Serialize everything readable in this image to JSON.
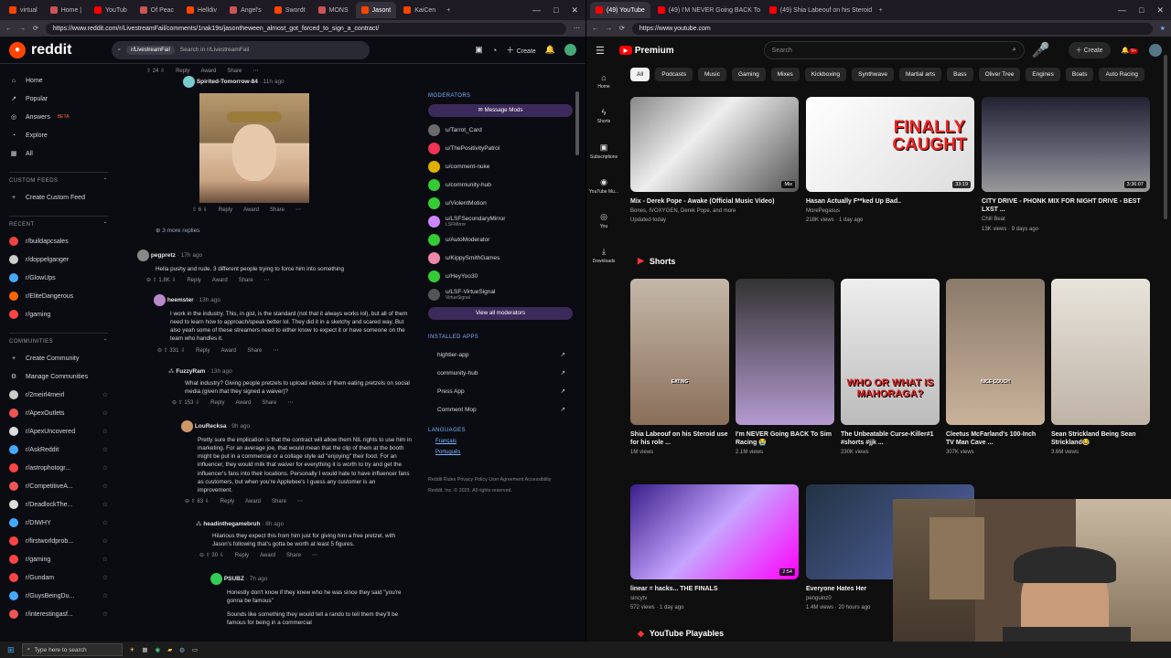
{
  "left_browser": {
    "tabs": [
      {
        "label": "virtual",
        "color": "#ff4500"
      },
      {
        "label": "Home |",
        "color": "#c55"
      },
      {
        "label": "YouTub",
        "color": "#f00"
      },
      {
        "label": "Of Peac",
        "color": "#c55"
      },
      {
        "label": "Helldiv",
        "color": "#ff4500"
      },
      {
        "label": "Angel's",
        "color": "#c55"
      },
      {
        "label": "Swordt",
        "color": "#ff4500"
      },
      {
        "label": "MONS",
        "color": "#c55"
      },
      {
        "label": "Jasont",
        "color": "#ff4500"
      },
      {
        "label": "KaiCen",
        "color": "#ff4500"
      }
    ],
    "url": "https://www.reddit.com/r/LivestreamFail/comments/1nak19s/jasontheween_almost_got_forced_to_sign_a_contract/"
  },
  "reddit": {
    "brand": "reddit",
    "search_chip": "r/LivestreamFail",
    "search_placeholder": "Search in r/LivestreamFail",
    "create": "Create",
    "nav": [
      "Home",
      "Popular",
      "Answers",
      "Explore",
      "All"
    ],
    "beta": "BETA",
    "custom_feeds_hdr": "CUSTOM FEEDS",
    "create_feed": "Create Custom Feed",
    "recent_hdr": "RECENT",
    "recent": [
      "r/buildapcsales",
      "r/doppelganger",
      "r/GlowUps",
      "r/EliteDangerous",
      "r/gaming"
    ],
    "communities_hdr": "COMMUNITIES",
    "create_community": "Create Community",
    "manage_communities": "Manage Communities",
    "communities": [
      "r/2meirl4meirl",
      "r/ApexOutlets",
      "r/ApexUncovered",
      "r/AskReddit",
      "r/astrophotogr...",
      "r/CompetitiveA...",
      "r/DeadlockThe...",
      "r/DIWHY",
      "r/firstworldprob...",
      "r/gaming",
      "r/Gundam",
      "r/GuysBeingDu...",
      "r/interestingasf..."
    ],
    "comments": [
      {
        "author": "Spirited-Tomorrow-84",
        "time": "· 11h ago",
        "votes": "6",
        "more": "3 more replies"
      },
      {
        "author": "pegpretz",
        "time": "· 17h ago",
        "body": "Hella pushy and rude. 3 different people trying to force him into something",
        "votes": "1.8K"
      },
      {
        "author": "heemster",
        "time": "· 13h ago",
        "body": "I work in the industry. This, in gist, is the standard (not that it always works lol), but all of them need to learn how to approach/speak better lol. They did it in a sketchy and scared way. But also yeah some of these streamers need to either know to expect it or have someone on the team who handles it.",
        "votes": "331"
      },
      {
        "author": "FuzzyRam",
        "time": "· 13h ago",
        "body": "What industry? Giving people pretzels to upload videos of them eating pretzels on social media (given that they signed a waiver)?",
        "votes": "153"
      },
      {
        "author": "LouRecksa",
        "time": "· 9h ago",
        "body": "Pretty sure the implication is that the contract will allow them NIL rights to use him in marketing. For an average joe, that would mean that the clip of them at the booth might be put in a commercial or a collage style ad \"enjoying\" their food. For an influencer, they would milk that waiver for everything it is worth to try and get the influencer's fans into their locations. Personally I would hate to have influencer fans as customers, but when you're Applebee's I guess any customer is an improvement.",
        "votes": "83"
      },
      {
        "author": "headinthegamebruh",
        "time": "· 8h ago",
        "body": "Hilarious they expect this from him just for giving him a free pretzel. with Jason's following that's gotta be worth at least 5 figures.",
        "votes": "30"
      },
      {
        "author": "PSUBZ",
        "time": "· 7h ago",
        "body": "Honestly don't know if they knew who he was since they said \"you're gonna be famous\"",
        "body2": "Sounds like something they would tell a rando to tell them they'll be famous for being in a commercial"
      }
    ],
    "top_votes": "24",
    "actions": {
      "reply": "Reply",
      "award": "Award",
      "share": "Share"
    },
    "moderators_hdr": "MODERATORS",
    "message_mods": "Message Mods",
    "moderators": [
      {
        "name": "u/Tarrot_Card",
        "sub": "",
        "color": "#6a6a6a"
      },
      {
        "name": "u/ThePositivityPatrol",
        "sub": "",
        "color": "#e35"
      },
      {
        "name": "u/comment-nuke",
        "sub": "",
        "color": "#e0b000"
      },
      {
        "name": "u/community-hub",
        "sub": "",
        "color": "#3c3"
      },
      {
        "name": "u/ViolentMotion",
        "sub": "",
        "color": "#3c3"
      },
      {
        "name": "u/LSFSecondaryMirror",
        "sub": "LSFMirror",
        "color": "#c8f"
      },
      {
        "name": "u/AutoModerator",
        "sub": "",
        "color": "#3c3"
      },
      {
        "name": "u/KippySmithGames",
        "sub": "",
        "color": "#e8a"
      },
      {
        "name": "u/HeyYoo30",
        "sub": "",
        "color": "#3c3"
      },
      {
        "name": "u/LSF-VirtueSignal",
        "sub": "VirtueSignal",
        "color": "#555"
      }
    ],
    "view_all_mods": "View all moderators",
    "installed_apps_hdr": "INSTALLED APPS",
    "apps": [
      "hightier-app",
      "community-hub",
      "Press App",
      "Comment Mop"
    ],
    "languages_hdr": "LANGUAGES",
    "languages": [
      "Français",
      "Português"
    ],
    "footer": "Reddit Rules   Privacy Policy   User Agreement   Accessibility",
    "copyright": "Reddit, Inc. © 2025. All rights reserved."
  },
  "right_browser": {
    "tabs": [
      {
        "label": "(49) YouTube",
        "color": "#f00"
      },
      {
        "label": "(49) I'M NEVER Going BACK To Si",
        "color": "#f00"
      },
      {
        "label": "(49) Shia Labeouf on his Steroid",
        "color": "#f00"
      }
    ],
    "url": "https://www.youtube.com"
  },
  "youtube": {
    "brand": "Premium",
    "search_placeholder": "Search",
    "create": "Create",
    "notif_count": "9+",
    "sidebar": [
      "Home",
      "Shorts",
      "Subscriptions",
      "YouTube Mu...",
      "You",
      "Downloads"
    ],
    "chips": [
      "All",
      "Podcasts",
      "Music",
      "Gaming",
      "Mixes",
      "Kickboxing",
      "Synthwave",
      "Martial arts",
      "Bass",
      "Oliver Tree",
      "Engines",
      "Boats",
      "Auto Racing"
    ],
    "videos": [
      {
        "title": "Mix - Derek Pope - Awake (Official Music Video)",
        "meta1": "Bones, IVOXYGEN, Derek Pope, and more",
        "meta2": "Updated today",
        "dur": "Mix"
      },
      {
        "title": "Hasan Actually F**ked Up Bad..",
        "meta1": "MorePegasus",
        "meta2": "218K views · 1 day ago",
        "dur": "33:19",
        "thumb_text": "FINALLY CAUGHT"
      },
      {
        "title": "CITY DRIVE - PHONK MIX FOR NIGHT DRIVE - BEST LXST ...",
        "meta1": "Chill Beat",
        "meta2": "13K views · 9 days ago",
        "dur": "3:36:07"
      }
    ],
    "shorts_hdr": "Shorts",
    "shorts": [
      {
        "title": "Shia Labeouf on his Steroid use for his role ...",
        "views": "1M views",
        "overlay": "EATING"
      },
      {
        "title": "I'm NEVER Going BACK To Sim Racing 😭",
        "views": "2.1M views",
        "overlay": ""
      },
      {
        "title": "The Unbeatable Curse-Killer#1 #shorts #jjk ...",
        "views": "230K views",
        "overlay": "WHO OR WHAT IS MAHORAGA?"
      },
      {
        "title": "Cleetus McFarland's 100-Inch TV Man Cave ...",
        "views": "307K views",
        "overlay": "NICE COUCH"
      },
      {
        "title": "Sean Strickland Being Sean Strickland😂",
        "views": "3.6M views",
        "overlay": ""
      }
    ],
    "row2": [
      {
        "title": "linear = hacks... THE FINALS",
        "meta1": "sincytv",
        "meta2": "572 views · 1 day ago",
        "dur": "2:54"
      },
      {
        "title": "Everyone Hates Her",
        "meta1": "penguinz0",
        "meta2": "1.4M views · 20 hours ago",
        "dur": ""
      }
    ],
    "playables": "YouTube Playables"
  },
  "taskbar": {
    "search": "Type here to search"
  }
}
